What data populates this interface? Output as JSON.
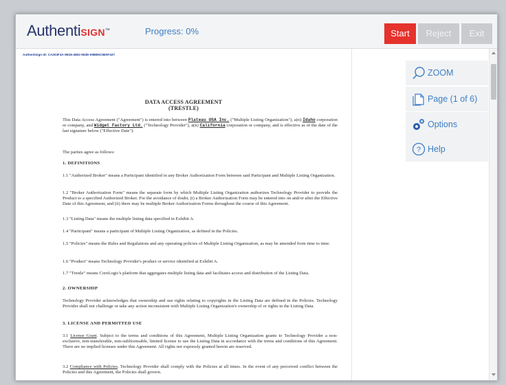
{
  "app": {
    "logo_main": "Authenti",
    "logo_accent": "SIGN",
    "logo_mark": "™"
  },
  "header": {
    "progress_label": "Progress: 0%",
    "progress_percent": 0,
    "buttons": {
      "start": "Start",
      "reject": "Reject",
      "exit": "Exit"
    }
  },
  "colors": {
    "brand_navy": "#27356b",
    "accent_red": "#e5322c",
    "link_blue": "#3d7fc4",
    "disabled_grey": "#c9cbcf"
  },
  "sidebar": {
    "items": [
      {
        "label": "ZOOM",
        "icon": "magnifier-icon"
      },
      {
        "label": "Page (1 of 6)",
        "icon": "pages-icon"
      },
      {
        "label": "Options",
        "icon": "gears-icon"
      },
      {
        "label": "Help",
        "icon": "help-icon"
      }
    ]
  },
  "document": {
    "id_line": "Authentisign ID: CA203F4A-9E26-4802-963D-09BB0C8E0F437",
    "title": "DATA ACCESS AGREEMENT",
    "subtitle": "(TRESTLE)",
    "intro": {
      "t1": "This Data Access Agreement (\"Agreement\") is entered into between ",
      "party1": "Plateau USA Inc.",
      "t2": " (\"Multiple Listing Organization\"), a(n) ",
      "state1": "Idaho",
      "t3": " corporation or company, and ",
      "party2": "Widget Factory Ltd.",
      "t4": " (\"Technology Provider\"), a(n) ",
      "state2": "California",
      "t5": " corporation or company, and is effective as of the date of the last signature below (\"Effective Date\")."
    },
    "parties_agree": "The parties agree as follows:",
    "sec1_heading": "1.  DEFINITIONS",
    "p1_1": "1.1  \"Authorized Broker\" means a Participant identified in any Broker Authorization Form between said Participant and Multiple Listing Organization.",
    "p1_2": "1.2  \"Broker Authorization Form\" means the separate form by which Multiple Listing Organization authorizes Technology Provider to provide the Product to a specified Authorized Broker. For the avoidance of doubt, (i) a Broker Authorization Form may be entered into on and/or after the Effective Date of this Agreement, and (ii) there may be multiple Broker Authorization Forms throughout the course of this Agreement.",
    "p1_3": "1.3  \"Listing Data\" means the multiple listing data specified in Exhibit A.",
    "p1_4": "1.4  \"Participant\" means a participant of Multiple Listing Organization, as defined in the Policies.",
    "p1_5": "1.5  \"Policies\" means the Rules and Regulations and any operating policies of Multiple Listing Organization, as may be amended from time to time.",
    "p1_6": "1.6  \"Product\" means Technology Provider's product or service identified at Exhibit A.",
    "p1_7": "1.7  \"Trestle\" means CoreLogic's platform that aggregates multiple listing data and facilitates access and distribution of the Listing Data.",
    "sec2_heading": "2.  OWNERSHIP",
    "p2": "Technology Provider acknowledges that ownership and use rights relating to copyrights in the Listing Data are defined in the Policies. Technology Provider shall not challenge or take any action inconsistent with Multiple Listing Organization's ownership of or rights in the Listing Data.",
    "sec3_heading": "3.  LICENSE AND PERMITTED USE",
    "p3_1_lead": "3.1 ",
    "p3_1_title": "License Grant",
    "p3_1_body": ". Subject to the terms and conditions of this Agreement, Multiple Listing Organization grants to Technology Provider a non-exclusive, non-transferable, non-sublicensable, limited license to use the Listing Data in accordance with the terms and conditions of this Agreement. There are no implied licenses under this Agreement. All rights not expressly granted herein are reserved.",
    "p3_2_lead": "3.2 ",
    "p3_2_title": "Compliance with Policies",
    "p3_2_body": ". Technology Provider shall comply with the Policies at all times. In the event of any perceived conflict between the Policies and this Agreement, the Policies shall govern."
  }
}
